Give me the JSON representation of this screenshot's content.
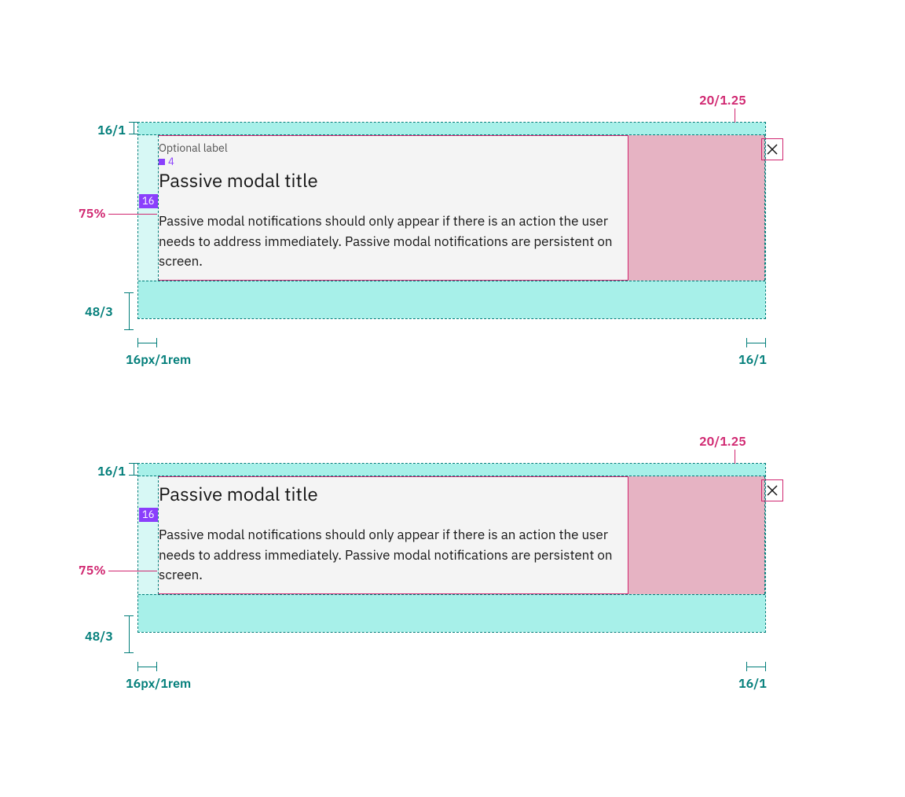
{
  "annotations": {
    "topPad": "16/1",
    "leftPadFull": "16px/1rem",
    "rightPad": "16/1",
    "bottomPad": "48/3",
    "contentWidth": "75%",
    "closeSize": "20/1.25",
    "spacing4": "4",
    "spacing16": "16"
  },
  "modal1": {
    "label": "Optional label",
    "title": "Passive modal title",
    "body": "Passive modal notifications should only appear if there is an action the user needs to address immediately. Passive modal notifications are persistent on screen."
  },
  "modal2": {
    "title": "Passive modal title",
    "body": "Passive modal notifications should only appear if there is an action the user needs to address immediately. Passive modal notifications are persistent on screen."
  },
  "colors": {
    "teal": "#007d79",
    "tealFill": "#a7f0e9",
    "pinkFill": "#e6b3c3",
    "pinkLine": "#d02670",
    "purple": "#8a3ffc"
  }
}
